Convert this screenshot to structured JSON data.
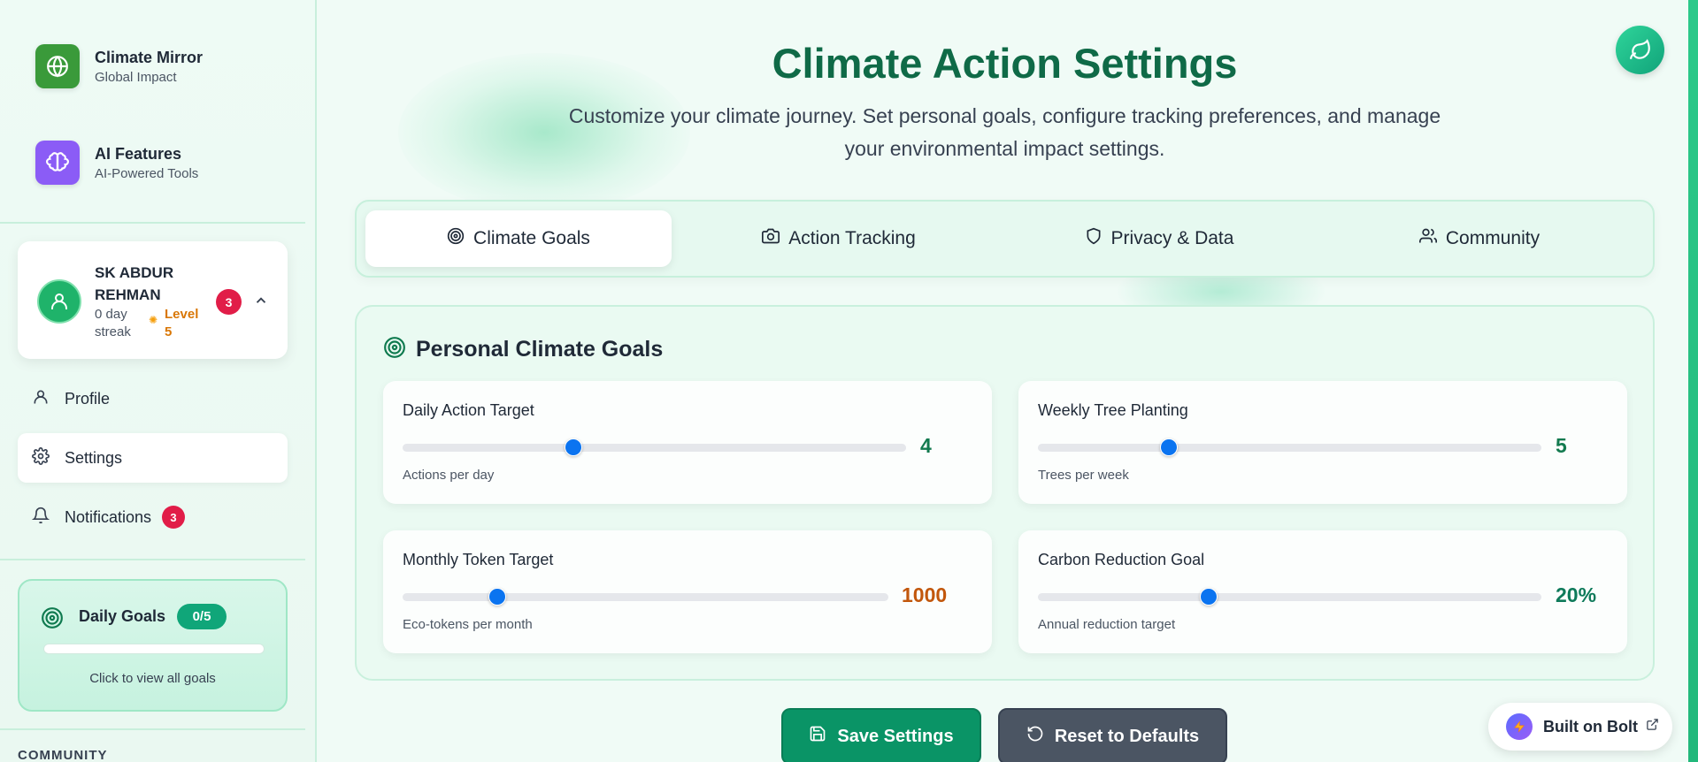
{
  "sidebar": {
    "brands": [
      {
        "title": "Climate Mirror",
        "subtitle": "Global Impact",
        "icon": "globe-icon",
        "color": "#3a9a3a"
      },
      {
        "title": "AI Features",
        "subtitle": "AI-Powered Tools",
        "icon": "brain-icon",
        "color": "#8b5cf6"
      }
    ],
    "user": {
      "name": "SK ABDUR REHMAN",
      "streak": "0 day streak",
      "level": "Level 5",
      "notifications": "3"
    },
    "nav": [
      {
        "label": "Profile",
        "icon": "user-icon"
      },
      {
        "label": "Settings",
        "icon": "gear-icon"
      },
      {
        "label": "Notifications",
        "icon": "bell-icon",
        "badge": "3"
      }
    ],
    "daily_goals": {
      "title": "Daily Goals",
      "count": "0/5",
      "progress": 0,
      "hint": "Click to view all goals"
    },
    "section_label": "COMMUNITY"
  },
  "header": {
    "title": "Climate Action Settings",
    "subtitle": "Customize your climate journey. Set personal goals, configure tracking preferences, and manage your environmental impact settings."
  },
  "tabs": [
    {
      "label": "Climate Goals",
      "icon": "target-icon",
      "active": true
    },
    {
      "label": "Action Tracking",
      "icon": "camera-icon"
    },
    {
      "label": "Privacy & Data",
      "icon": "shield-icon"
    },
    {
      "label": "Community",
      "icon": "users-icon"
    }
  ],
  "panel": {
    "title": "Personal Climate Goals",
    "goals": [
      {
        "label": "Daily Action Target",
        "value": "4",
        "description": "Actions per day",
        "slider_fraction": 0.34,
        "color": "#137a4f"
      },
      {
        "label": "Weekly Tree Planting",
        "value": "5",
        "description": "Trees per week",
        "slider_fraction": 0.26,
        "color": "#137a4f"
      },
      {
        "label": "Monthly Token Target",
        "value": "1000",
        "description": "Eco-tokens per month",
        "slider_fraction": 0.195,
        "color": "#c2570c"
      },
      {
        "label": "Carbon Reduction Goal",
        "value": "20%",
        "description": "Annual reduction target",
        "slider_fraction": 0.34,
        "color": "#0e7a5a"
      }
    ]
  },
  "actions": {
    "save": "Save Settings",
    "reset": "Reset to Defaults"
  },
  "footer_badge": "Built on Bolt",
  "colors": {
    "accent": "#0a9466",
    "title": "#0f6a47",
    "slider_thumb": "#0b74f0"
  }
}
